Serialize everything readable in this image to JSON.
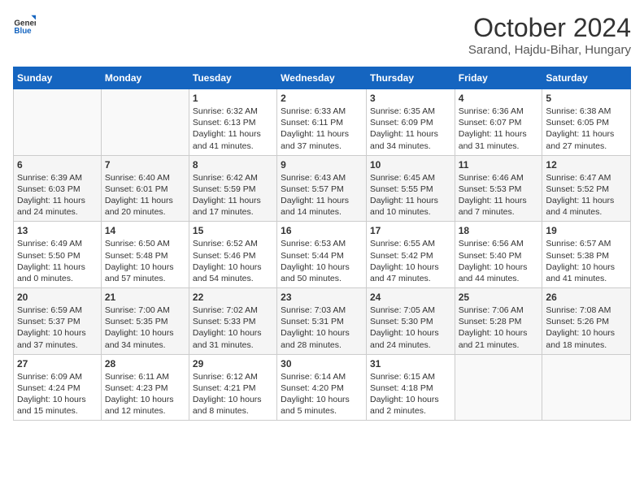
{
  "header": {
    "logo_general": "General",
    "logo_blue": "Blue",
    "title": "October 2024",
    "subtitle": "Sarand, Hajdu-Bihar, Hungary"
  },
  "days_of_week": [
    "Sunday",
    "Monday",
    "Tuesday",
    "Wednesday",
    "Thursday",
    "Friday",
    "Saturday"
  ],
  "weeks": [
    [
      {
        "day": "",
        "sunrise": "",
        "sunset": "",
        "daylight": ""
      },
      {
        "day": "",
        "sunrise": "",
        "sunset": "",
        "daylight": ""
      },
      {
        "day": "1",
        "sunrise": "Sunrise: 6:32 AM",
        "sunset": "Sunset: 6:13 PM",
        "daylight": "Daylight: 11 hours and 41 minutes."
      },
      {
        "day": "2",
        "sunrise": "Sunrise: 6:33 AM",
        "sunset": "Sunset: 6:11 PM",
        "daylight": "Daylight: 11 hours and 37 minutes."
      },
      {
        "day": "3",
        "sunrise": "Sunrise: 6:35 AM",
        "sunset": "Sunset: 6:09 PM",
        "daylight": "Daylight: 11 hours and 34 minutes."
      },
      {
        "day": "4",
        "sunrise": "Sunrise: 6:36 AM",
        "sunset": "Sunset: 6:07 PM",
        "daylight": "Daylight: 11 hours and 31 minutes."
      },
      {
        "day": "5",
        "sunrise": "Sunrise: 6:38 AM",
        "sunset": "Sunset: 6:05 PM",
        "daylight": "Daylight: 11 hours and 27 minutes."
      }
    ],
    [
      {
        "day": "6",
        "sunrise": "Sunrise: 6:39 AM",
        "sunset": "Sunset: 6:03 PM",
        "daylight": "Daylight: 11 hours and 24 minutes."
      },
      {
        "day": "7",
        "sunrise": "Sunrise: 6:40 AM",
        "sunset": "Sunset: 6:01 PM",
        "daylight": "Daylight: 11 hours and 20 minutes."
      },
      {
        "day": "8",
        "sunrise": "Sunrise: 6:42 AM",
        "sunset": "Sunset: 5:59 PM",
        "daylight": "Daylight: 11 hours and 17 minutes."
      },
      {
        "day": "9",
        "sunrise": "Sunrise: 6:43 AM",
        "sunset": "Sunset: 5:57 PM",
        "daylight": "Daylight: 11 hours and 14 minutes."
      },
      {
        "day": "10",
        "sunrise": "Sunrise: 6:45 AM",
        "sunset": "Sunset: 5:55 PM",
        "daylight": "Daylight: 11 hours and 10 minutes."
      },
      {
        "day": "11",
        "sunrise": "Sunrise: 6:46 AM",
        "sunset": "Sunset: 5:53 PM",
        "daylight": "Daylight: 11 hours and 7 minutes."
      },
      {
        "day": "12",
        "sunrise": "Sunrise: 6:47 AM",
        "sunset": "Sunset: 5:52 PM",
        "daylight": "Daylight: 11 hours and 4 minutes."
      }
    ],
    [
      {
        "day": "13",
        "sunrise": "Sunrise: 6:49 AM",
        "sunset": "Sunset: 5:50 PM",
        "daylight": "Daylight: 11 hours and 0 minutes."
      },
      {
        "day": "14",
        "sunrise": "Sunrise: 6:50 AM",
        "sunset": "Sunset: 5:48 PM",
        "daylight": "Daylight: 10 hours and 57 minutes."
      },
      {
        "day": "15",
        "sunrise": "Sunrise: 6:52 AM",
        "sunset": "Sunset: 5:46 PM",
        "daylight": "Daylight: 10 hours and 54 minutes."
      },
      {
        "day": "16",
        "sunrise": "Sunrise: 6:53 AM",
        "sunset": "Sunset: 5:44 PM",
        "daylight": "Daylight: 10 hours and 50 minutes."
      },
      {
        "day": "17",
        "sunrise": "Sunrise: 6:55 AM",
        "sunset": "Sunset: 5:42 PM",
        "daylight": "Daylight: 10 hours and 47 minutes."
      },
      {
        "day": "18",
        "sunrise": "Sunrise: 6:56 AM",
        "sunset": "Sunset: 5:40 PM",
        "daylight": "Daylight: 10 hours and 44 minutes."
      },
      {
        "day": "19",
        "sunrise": "Sunrise: 6:57 AM",
        "sunset": "Sunset: 5:38 PM",
        "daylight": "Daylight: 10 hours and 41 minutes."
      }
    ],
    [
      {
        "day": "20",
        "sunrise": "Sunrise: 6:59 AM",
        "sunset": "Sunset: 5:37 PM",
        "daylight": "Daylight: 10 hours and 37 minutes."
      },
      {
        "day": "21",
        "sunrise": "Sunrise: 7:00 AM",
        "sunset": "Sunset: 5:35 PM",
        "daylight": "Daylight: 10 hours and 34 minutes."
      },
      {
        "day": "22",
        "sunrise": "Sunrise: 7:02 AM",
        "sunset": "Sunset: 5:33 PM",
        "daylight": "Daylight: 10 hours and 31 minutes."
      },
      {
        "day": "23",
        "sunrise": "Sunrise: 7:03 AM",
        "sunset": "Sunset: 5:31 PM",
        "daylight": "Daylight: 10 hours and 28 minutes."
      },
      {
        "day": "24",
        "sunrise": "Sunrise: 7:05 AM",
        "sunset": "Sunset: 5:30 PM",
        "daylight": "Daylight: 10 hours and 24 minutes."
      },
      {
        "day": "25",
        "sunrise": "Sunrise: 7:06 AM",
        "sunset": "Sunset: 5:28 PM",
        "daylight": "Daylight: 10 hours and 21 minutes."
      },
      {
        "day": "26",
        "sunrise": "Sunrise: 7:08 AM",
        "sunset": "Sunset: 5:26 PM",
        "daylight": "Daylight: 10 hours and 18 minutes."
      }
    ],
    [
      {
        "day": "27",
        "sunrise": "Sunrise: 6:09 AM",
        "sunset": "Sunset: 4:24 PM",
        "daylight": "Daylight: 10 hours and 15 minutes."
      },
      {
        "day": "28",
        "sunrise": "Sunrise: 6:11 AM",
        "sunset": "Sunset: 4:23 PM",
        "daylight": "Daylight: 10 hours and 12 minutes."
      },
      {
        "day": "29",
        "sunrise": "Sunrise: 6:12 AM",
        "sunset": "Sunset: 4:21 PM",
        "daylight": "Daylight: 10 hours and 8 minutes."
      },
      {
        "day": "30",
        "sunrise": "Sunrise: 6:14 AM",
        "sunset": "Sunset: 4:20 PM",
        "daylight": "Daylight: 10 hours and 5 minutes."
      },
      {
        "day": "31",
        "sunrise": "Sunrise: 6:15 AM",
        "sunset": "Sunset: 4:18 PM",
        "daylight": "Daylight: 10 hours and 2 minutes."
      },
      {
        "day": "",
        "sunrise": "",
        "sunset": "",
        "daylight": ""
      },
      {
        "day": "",
        "sunrise": "",
        "sunset": "",
        "daylight": ""
      }
    ]
  ]
}
